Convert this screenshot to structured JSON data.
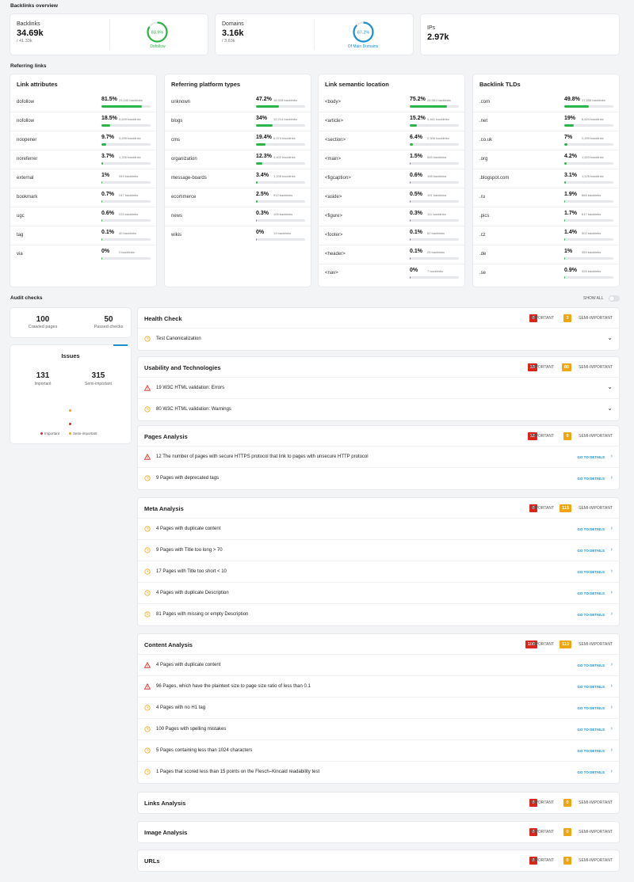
{
  "overview": {
    "title": "Backlinks overview",
    "backlinks": {
      "label": "Backlinks",
      "value": "34.69k",
      "sub": "/ 41.33k",
      "ring_value": "83.9%",
      "ring_caption": "Dofollow",
      "ring_fraction": 0.839
    },
    "domains": {
      "label": "Domains",
      "value": "3.16k",
      "sub": "/ 3.63k",
      "ring_value": "87.2%",
      "ring_caption": "Of Main Domains",
      "ring_fraction": 0.872
    },
    "ips": {
      "label": "IPs",
      "value": "2.97k"
    }
  },
  "referring": {
    "title": "Referring links",
    "cards": [
      {
        "title": "Link attributes",
        "rows": [
          {
            "name": "dofollow",
            "value": "81.5%",
            "sub": "29,240 backlinks",
            "fraction": 0.815
          },
          {
            "name": "nofollow",
            "value": "18.5%",
            "sub": "6,649 backlinks",
            "fraction": 0.185
          },
          {
            "name": "noopener",
            "value": "9.7%",
            "sub": "3,495 backlinks",
            "fraction": 0.097
          },
          {
            "name": "noreferrer",
            "value": "3.7%",
            "sub": "1,336 backlinks",
            "fraction": 0.037
          },
          {
            "name": "external",
            "value": "1%",
            "sub": "349 backlinks",
            "fraction": 0.01
          },
          {
            "name": "bookmark",
            "value": "0.7%",
            "sub": "247 backlinks",
            "fraction": 0.007
          },
          {
            "name": "ugc",
            "value": "0.6%",
            "sub": "233 backlinks",
            "fraction": 0.006
          },
          {
            "name": "tag",
            "value": "0.1%",
            "sub": "40 backlinks",
            "fraction": 0.001
          },
          {
            "name": "via",
            "value": "0%",
            "sub": "2 backlinks",
            "fraction": 0.0
          }
        ]
      },
      {
        "title": "Referring platform types",
        "rows": [
          {
            "name": "unknown",
            "value": "47.2%",
            "sub": "16,928 backlinks",
            "fraction": 0.472
          },
          {
            "name": "blogs",
            "value": "34%",
            "sub": "12,214 backlinks",
            "fraction": 0.34
          },
          {
            "name": "cms",
            "value": "19.4%",
            "sub": "6,974 backlinks",
            "fraction": 0.194
          },
          {
            "name": "organization",
            "value": "12.3%",
            "sub": "4,402 backlinks",
            "fraction": 0.123
          },
          {
            "name": "message-boards",
            "value": "3.4%",
            "sub": "1,208 backlinks",
            "fraction": 0.034
          },
          {
            "name": "ecommerce",
            "value": "2.5%",
            "sub": "912 backlinks",
            "fraction": 0.025
          },
          {
            "name": "news",
            "value": "0.3%",
            "sub": "106 backlinks",
            "fraction": 0.003
          },
          {
            "name": "wikis",
            "value": "0%",
            "sub": "13 backlinks",
            "fraction": 0.0
          }
        ]
      },
      {
        "title": "Link semantic location",
        "rows": [
          {
            "name": "<body>",
            "value": "75.2%",
            "sub": "26,981 backlinks",
            "fraction": 0.752
          },
          {
            "name": "<article>",
            "value": "15.2%",
            "sub": "5,461 backlinks",
            "fraction": 0.152
          },
          {
            "name": "<section>",
            "value": "6.4%",
            "sub": "2,306 backlinks",
            "fraction": 0.064
          },
          {
            "name": "<main>",
            "value": "1.5%",
            "sub": "545 backlinks",
            "fraction": 0.015
          },
          {
            "name": "<figcaption>",
            "value": "0.6%",
            "sub": "198 backlinks",
            "fraction": 0.006
          },
          {
            "name": "<aside>",
            "value": "0.5%",
            "sub": "191 backlinks",
            "fraction": 0.005
          },
          {
            "name": "<figure>",
            "value": "0.3%",
            "sub": "111 backlinks",
            "fraction": 0.003
          },
          {
            "name": "<footer>",
            "value": "0.1%",
            "sub": "52 backlinks",
            "fraction": 0.001
          },
          {
            "name": "<header>",
            "value": "0.1%",
            "sub": "25 backlinks",
            "fraction": 0.001
          },
          {
            "name": "<nav>",
            "value": "0%",
            "sub": "7 backlinks",
            "fraction": 0.0
          }
        ]
      },
      {
        "title": "Backlink TLDs",
        "rows": [
          {
            "name": ".com",
            "value": "49.8%",
            "sub": "17,858 backlinks",
            "fraction": 0.498
          },
          {
            "name": ".net",
            "value": "19%",
            "sub": "6,824 backlinks",
            "fraction": 0.19
          },
          {
            "name": ".co.uk",
            "value": "7%",
            "sub": "2,499 backlinks",
            "fraction": 0.07
          },
          {
            "name": ".org",
            "value": "4.2%",
            "sub": "1,503 backlinks",
            "fraction": 0.042
          },
          {
            "name": ".blogspot.com",
            "value": "3.1%",
            "sub": "1,126 backlinks",
            "fraction": 0.031
          },
          {
            "name": ".ru",
            "value": "1.9%",
            "sub": "666 backlinks",
            "fraction": 0.019
          },
          {
            "name": ".pics",
            "value": "1.7%",
            "sub": "617 backlinks",
            "fraction": 0.017
          },
          {
            "name": ".cz",
            "value": "1.4%",
            "sub": "502 backlinks",
            "fraction": 0.014
          },
          {
            "name": ".de",
            "value": "1%",
            "sub": "350 backlinks",
            "fraction": 0.01
          },
          {
            "name": ".se",
            "value": "0.9%",
            "sub": "326 backlinks",
            "fraction": 0.009
          }
        ]
      }
    ]
  },
  "audit": {
    "title": "Audit checks",
    "show_all": "SHOW ALL",
    "stats": {
      "crawled_value": "100",
      "crawled_label": "Crawled pages",
      "passed_value": "50",
      "passed_label": "Passed checks"
    },
    "issues": {
      "title": "Issues",
      "important_value": "131",
      "important_label": "Important",
      "semi_value": "315",
      "semi_label": "Semi-important",
      "legend_important": "Important",
      "legend_semi": "Semi-important"
    },
    "important_label": "IMPORTANT",
    "semi_label": "SEMI-IMPORTANT",
    "go_label": "GO TO DETAILS",
    "colors": {
      "important": "#d9261c",
      "semi": "#f0a513",
      "link": "#1a8fd1",
      "bar": "#28b446"
    },
    "panels": [
      {
        "title": "Health Check",
        "important": "0",
        "semi": "3",
        "items": [
          {
            "text": "Test Canonicalization",
            "severity": "semi",
            "action": "expand"
          }
        ]
      },
      {
        "title": "Usability and Technologies",
        "important": "19",
        "semi": "80",
        "items": [
          {
            "text": "19 W3C HTML validation: Errors",
            "severity": "important",
            "action": "expand"
          },
          {
            "text": "80 W3C HTML validation: Warnings",
            "severity": "semi",
            "action": "expand"
          }
        ]
      },
      {
        "title": "Pages Analysis",
        "important": "12",
        "semi": "9",
        "items": [
          {
            "text": "12 The number of pages with secure HTTPS protocol that link to pages with unsecure HTTP protocol",
            "severity": "important",
            "action": "details"
          },
          {
            "text": "9 Pages with deprecated tags",
            "severity": "semi",
            "action": "details"
          }
        ]
      },
      {
        "title": "Meta Analysis",
        "important": "0",
        "semi": "115",
        "items": [
          {
            "text": "4 Pages with duplicate content",
            "severity": "semi",
            "action": "details"
          },
          {
            "text": "9 Pages with Title too long > 70",
            "severity": "semi",
            "action": "details"
          },
          {
            "text": "17 Pages with Title too short < 10",
            "severity": "semi",
            "action": "details"
          },
          {
            "text": "4 Pages with duplicate Description",
            "severity": "semi",
            "action": "details"
          },
          {
            "text": "81 Pages with missing or empty Description",
            "severity": "semi",
            "action": "details"
          }
        ]
      },
      {
        "title": "Content Analysis",
        "important": "100",
        "semi": "110",
        "items": [
          {
            "text": "4 Pages with duplicate content",
            "severity": "important",
            "action": "details"
          },
          {
            "text": "96 Pages, which have the plaintext size to page size ratio of less than 0.1",
            "severity": "important",
            "action": "details"
          },
          {
            "text": "4 Pages with no H1 tag",
            "severity": "semi",
            "action": "details"
          },
          {
            "text": "100 Pages with spelling mistakes",
            "severity": "semi",
            "action": "details"
          },
          {
            "text": "5 Pages containing less than 1024 characters",
            "severity": "semi",
            "action": "details"
          },
          {
            "text": "1 Pages that scored less than 15 points on the Flesch–Kincaid readability test",
            "severity": "semi",
            "action": "details"
          }
        ]
      },
      {
        "title": "Links Analysis",
        "important": "0",
        "semi": "0",
        "items": []
      },
      {
        "title": "Image Analysis",
        "important": "0",
        "semi": "0",
        "items": []
      },
      {
        "title": "URLs",
        "important": "0",
        "semi": "0",
        "items": []
      }
    ]
  }
}
